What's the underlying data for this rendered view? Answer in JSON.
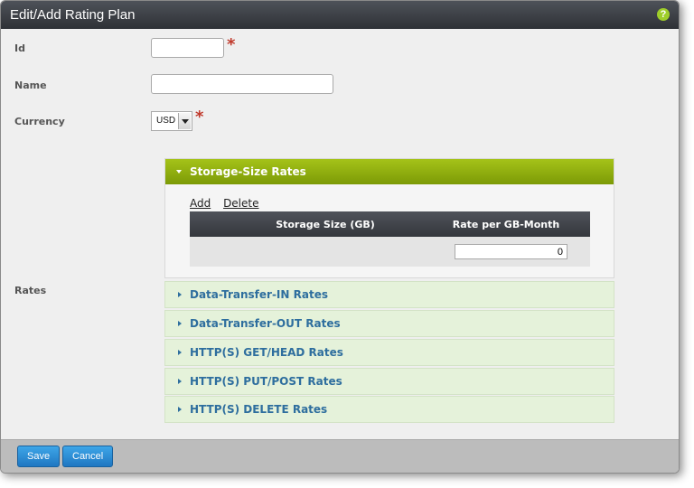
{
  "dialog": {
    "title": "Edit/Add Rating Plan",
    "help_icon": "question-icon",
    "help_glyph": "?"
  },
  "form": {
    "id_label": "Id",
    "id_value": "",
    "name_label": "Name",
    "name_value": "",
    "currency_label": "Currency",
    "currency_value": "USD",
    "required_mark": "*",
    "rates_label": "Rates"
  },
  "rates": {
    "storage": {
      "title": "Storage-Size Rates",
      "add_label": "Add",
      "delete_label": "Delete",
      "columns": [
        "Storage Size (GB)",
        "Rate per GB-Month"
      ],
      "rows": [
        {
          "storage_size": "",
          "rate": "0"
        }
      ]
    },
    "collapsed_sections": [
      "Data-Transfer-IN Rates",
      "Data-Transfer-OUT Rates",
      "HTTP(S) GET/HEAD Rates",
      "HTTP(S) PUT/POST Rates",
      "HTTP(S) DELETE Rates"
    ]
  },
  "footer": {
    "save_label": "Save",
    "cancel_label": "Cancel"
  },
  "colors": {
    "titlebar": "#3a3d43",
    "accent_green": "#8fad0f",
    "collapsed_header": "#e5f2da",
    "collapsed_text": "#2e6e9e",
    "button_blue": "#2a8ad6",
    "required": "#c0392b"
  }
}
